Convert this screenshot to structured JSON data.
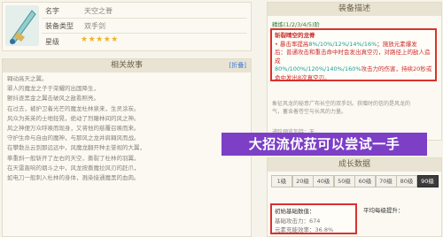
{
  "weapon": {
    "name_label": "名字",
    "name_value": "天空之脊",
    "type_label": "装备类型",
    "type_value": "双手剑",
    "rarity_label": "星级",
    "stars": "★★★★★"
  },
  "story": {
    "header": "相关故事",
    "toggle": "[折叠]",
    "lines": [
      "翱动高天之翼。",
      "",
      "罪人的魔龙之子于荣耀的出国降生，",
      "",
      "颤抖逐黑金之翼击破风之敌看照亮。",
      "",
      "在过去，被护卫着光芒的魔龙杜林泉来，生灵涂炭。",
      "",
      "风众为英英的士地轻晃，绝动了烈瞳林间的风之神。",
      "",
      "风之神便万众呼唤而现身，又将他的慈覆召唤而来。",
      "",
      "守护生命与自由的魔神，与那风之龙并肩翱风而战。",
      "",
      "在攀散丛云到那远远中，风魔龙翻开种主誉视的大翼，",
      "",
      "拳重斜一般斩开了左右的天空，撕裂了杜林的羽翼。",
      "",
      "在天雷轰响的烟斗之中，风龙按撕魔拉风刃的赶爪，",
      "",
      "如电刀一般刺入杜林的身体，溅染接通魔黑的血肉。"
    ]
  },
  "overlay": {
    "text": "大招流优菈可以尝试一手"
  },
  "equip": {
    "header": "装备描述",
    "refine": "精炼(1/2/3/4/5)阶",
    "passive_name": "斩裂晴空的龙脊",
    "passive_lines": [
      {
        "prefix": "• 暴击率提高",
        "value": "8%/10%/12%/14%/16%",
        "suffix": "；施放元素爆发"
      },
      {
        "prefix": "后：普通攻击和重击命中时会发出真空刃，对路径上的敌人造成",
        "value": "",
        "suffix": ""
      },
      {
        "prefix": "",
        "value": "80%/100%/120%/140%/160%",
        "suffix": "攻击力的伤害，持续20秒或"
      },
      {
        "prefix": "命中发出8次真空刃。",
        "value": "",
        "suffix": ""
      }
    ],
    "desc_lines": [
      "象征风龙的秘意广布长空的双手剑。获赠时的信的是风龙的",
      "气，蓄含着苍空与长风的力量。"
    ],
    "bottom_label": "进阶预览加持：无"
  },
  "growth": {
    "header": "成长数据",
    "levels": [
      "1级",
      "20级",
      "40级",
      "50级",
      "60级",
      "70级",
      "80级",
      "90级"
    ],
    "active_level": "90级",
    "base_header": "初始基础数值：",
    "extra_header": "平均每级提升：",
    "atk_label": "基础攻击力：",
    "atk_value": "674",
    "sub_label": "元素充能效率：",
    "sub_value": "36.8%"
  },
  "colors": {
    "highlight_red": "#d9322e",
    "teal": "#1a9e9a",
    "banner_purple": "#7c3fc6"
  }
}
